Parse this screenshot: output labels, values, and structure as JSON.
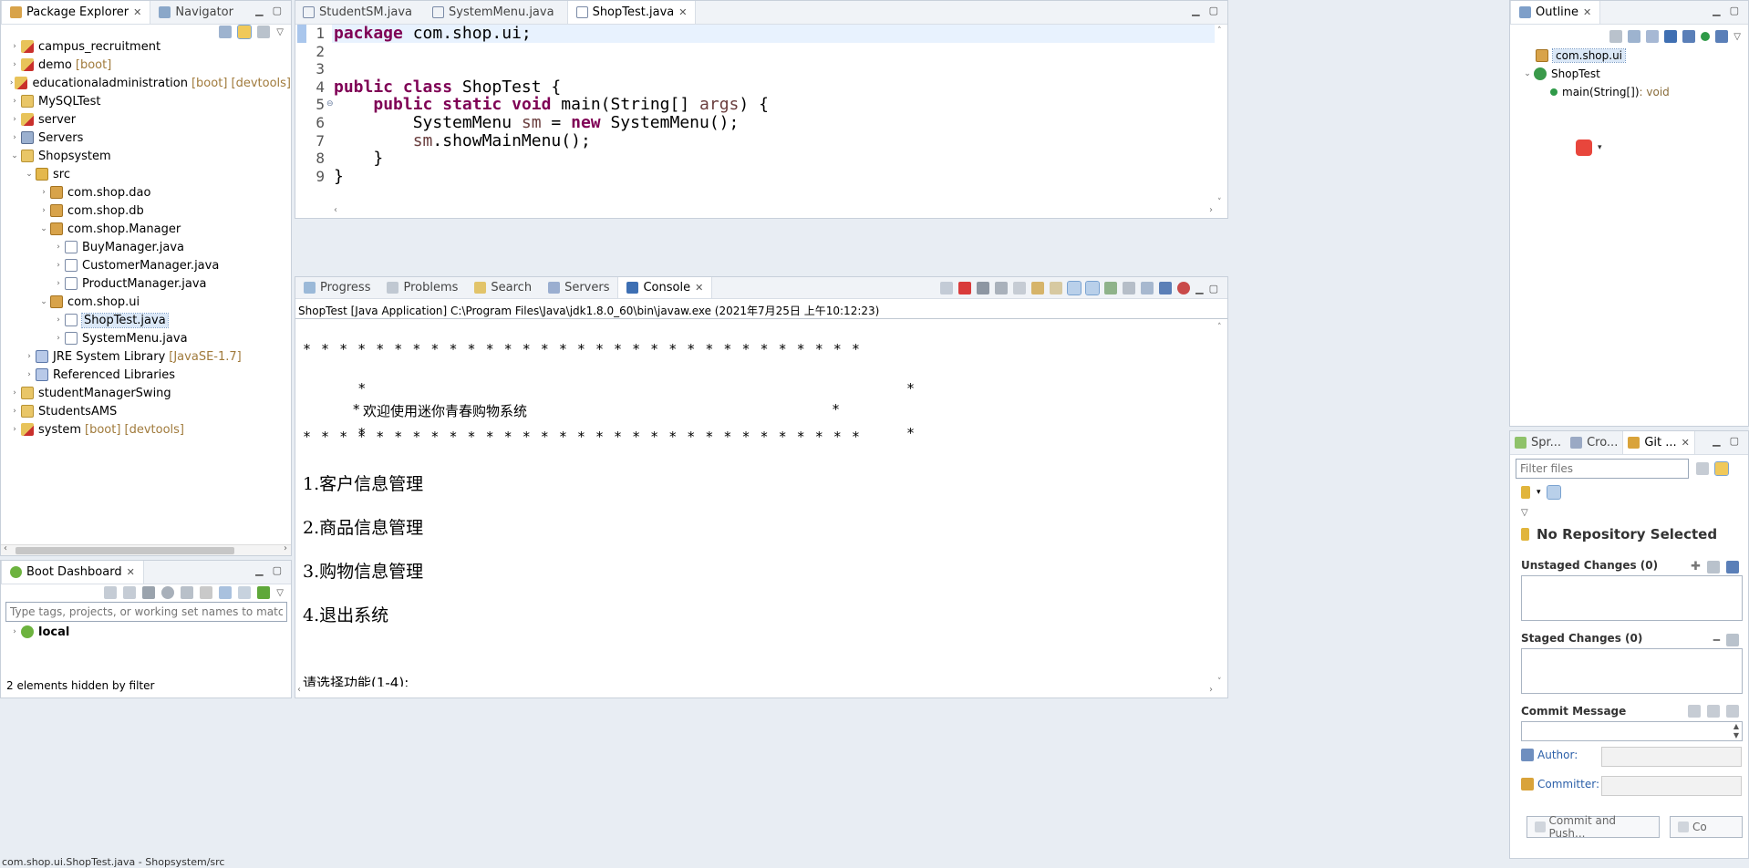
{
  "package_explorer": {
    "tabs": [
      "Package Explorer",
      "Navigator"
    ],
    "tree": [
      {
        "label": "campus_recruitment",
        "deco": "",
        "depth": 0,
        "arrow": "›",
        "icon": "proj"
      },
      {
        "label": "demo",
        "deco": "[boot]",
        "depth": 0,
        "arrow": "›",
        "icon": "proj"
      },
      {
        "label": "educationaladministration",
        "deco": "[boot] [devtools]",
        "depth": 0,
        "arrow": "›",
        "icon": "proj"
      },
      {
        "label": "MySQLTest",
        "deco": "",
        "depth": 0,
        "arrow": "›",
        "icon": "folder"
      },
      {
        "label": "server",
        "deco": "",
        "depth": 0,
        "arrow": "›",
        "icon": "proj"
      },
      {
        "label": "Servers",
        "deco": "",
        "depth": 0,
        "arrow": "›",
        "icon": "server"
      },
      {
        "label": "Shopsystem",
        "deco": "",
        "depth": 0,
        "arrow": "⌄",
        "icon": "folder"
      },
      {
        "label": "src",
        "deco": "",
        "depth": 1,
        "arrow": "⌄",
        "icon": "src"
      },
      {
        "label": "com.shop.dao",
        "deco": "",
        "depth": 2,
        "arrow": "›",
        "icon": "pkg"
      },
      {
        "label": "com.shop.db",
        "deco": "",
        "depth": 2,
        "arrow": "›",
        "icon": "pkg"
      },
      {
        "label": "com.shop.Manager",
        "deco": "",
        "depth": 2,
        "arrow": "⌄",
        "icon": "pkg"
      },
      {
        "label": "BuyManager.java",
        "deco": "",
        "depth": 3,
        "arrow": "›",
        "icon": "java"
      },
      {
        "label": "CustomerManager.java",
        "deco": "",
        "depth": 3,
        "arrow": "›",
        "icon": "java"
      },
      {
        "label": "ProductManager.java",
        "deco": "",
        "depth": 3,
        "arrow": "›",
        "icon": "java"
      },
      {
        "label": "com.shop.ui",
        "deco": "",
        "depth": 2,
        "arrow": "⌄",
        "icon": "pkg"
      },
      {
        "label": "ShopTest.java",
        "deco": "",
        "depth": 3,
        "arrow": "›",
        "icon": "java",
        "selected": true
      },
      {
        "label": "SystemMenu.java",
        "deco": "",
        "depth": 3,
        "arrow": "›",
        "icon": "java"
      },
      {
        "label": "JRE System Library",
        "deco": "[JavaSE-1.7]",
        "depth": 1,
        "arrow": "›",
        "icon": "lib"
      },
      {
        "label": "Referenced Libraries",
        "deco": "",
        "depth": 1,
        "arrow": "›",
        "icon": "lib"
      },
      {
        "label": "studentManagerSwing",
        "deco": "",
        "depth": 0,
        "arrow": "›",
        "icon": "folder"
      },
      {
        "label": "StudentsAMS",
        "deco": "",
        "depth": 0,
        "arrow": "›",
        "icon": "folder"
      },
      {
        "label": "system",
        "deco": "[boot] [devtools]",
        "depth": 0,
        "arrow": "›",
        "icon": "proj"
      }
    ]
  },
  "boot_dashboard": {
    "tab": "Boot Dashboard",
    "filter_placeholder": "Type tags, projects, or working set names to match (incl. * and ?",
    "local_label": "local",
    "hidden_note": "2 elements hidden by filter"
  },
  "editor": {
    "tabs": [
      "StudentSM.java",
      "SystemMenu.java",
      "ShopTest.java"
    ],
    "active_tab": "ShopTest.java",
    "line_numbers": [
      "1",
      "2",
      "3",
      "4",
      "5",
      "6",
      "7",
      "8",
      "9"
    ],
    "lines": {
      "l1_kw": "package",
      "l1_rest": " com.shop.ui;",
      "l4_kw1": "public",
      "l4_kw2": "class",
      "l4_rest": " ShopTest {",
      "l5_indent": "    ",
      "l5_kw1": "public",
      "l5_kw2": "static",
      "l5_kw3": "void",
      "l5_mid": " main(String[] ",
      "l5_var": "args",
      "l5_end": ") {",
      "l6_pre": "        SystemMenu ",
      "l6_var": "sm",
      "l6_mid": " = ",
      "l6_kw": "new",
      "l6_end": " SystemMenu();",
      "l7_pre": "        ",
      "l7_var": "sm",
      "l7_end": ".showMainMenu();",
      "l8": "    }",
      "l9": "}"
    }
  },
  "bottom_panel": {
    "tabs": [
      "Progress",
      "Problems",
      "Search",
      "Servers",
      "Console"
    ],
    "active_tab": "Console",
    "launch_info": "ShopTest [Java Application] C:\\Program Files\\Java\\jdk1.8.0_60\\bin\\javaw.exe (2021年7月25日 上午10:12:23)",
    "console": {
      "stars_row": "* * * * * * * * * * * * * * * * * * * * * * * * * * * * * * *",
      "edge_row": "*                                                                                                                                                       *",
      "welcome_prefix": "*",
      "welcome_text": "欢迎使用迷你青春购物系统",
      "welcome_suffix": "*",
      "menu": [
        "1.客户信息管理",
        "2.商品信息管理",
        "3.购物信息管理",
        "4.退出系统"
      ],
      "prompt": "请选择功能(1-4):"
    }
  },
  "outline": {
    "tab": "Outline",
    "items": [
      {
        "label": "com.shop.ui",
        "type": ""
      },
      {
        "label": "ShopTest",
        "type": ""
      },
      {
        "label": "main(String[])",
        "type": " : void"
      }
    ]
  },
  "git_panel": {
    "tabs": [
      "Spr...",
      "Cro...",
      "Git ..."
    ],
    "filter_placeholder": "Filter files",
    "no_repo": "No Repository Selected",
    "unstaged": "Unstaged Changes (0)",
    "staged": "Staged Changes (0)",
    "commit_message": "Commit Message",
    "author": "Author:",
    "committer": "Committer:",
    "commit_push": "Commit and Push...",
    "commit": "Co"
  },
  "status_bar": {
    "text": "com.shop.ui.ShopTest.java - Shopsystem/src"
  },
  "colors": {
    "keyword": "#7f0055",
    "variable": "#6a3e3e",
    "deco": "#a07a3b"
  }
}
